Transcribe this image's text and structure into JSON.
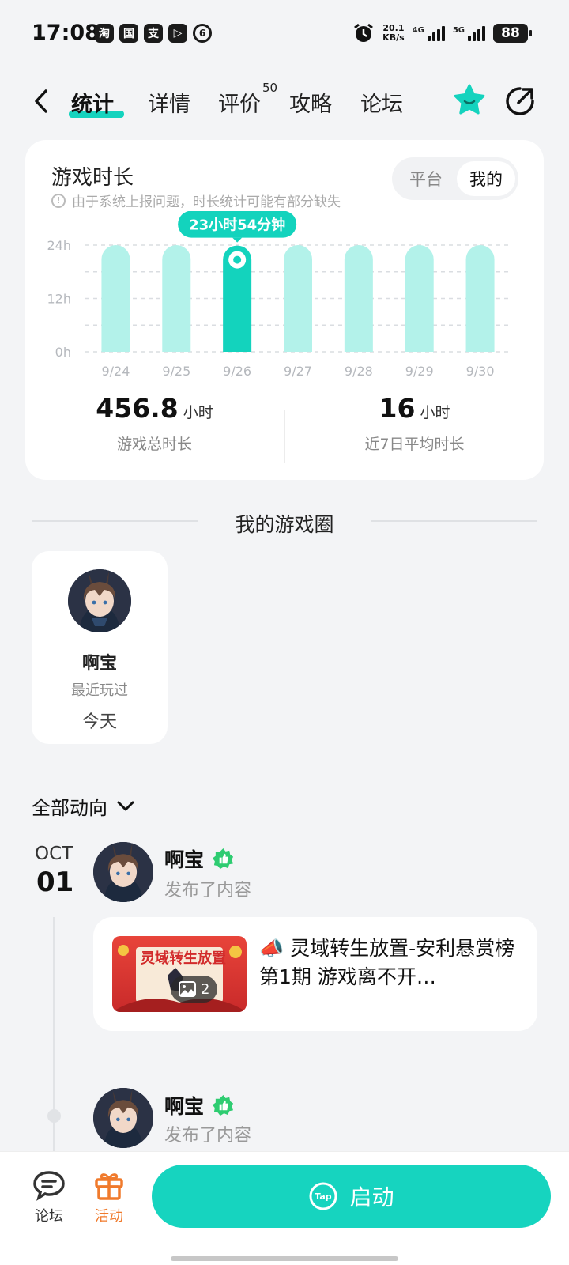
{
  "status_bar": {
    "time": "17:08",
    "apps": [
      "淘",
      "国",
      "支",
      "▷",
      "6"
    ],
    "speed_value": "20.1",
    "speed_unit": "KB/s",
    "net1": "4G",
    "net2": "5G",
    "battery": "88"
  },
  "nav": {
    "tabs": [
      {
        "label": "统计",
        "active": true
      },
      {
        "label": "详情"
      },
      {
        "label": "评价"
      },
      {
        "label": "攻略"
      },
      {
        "label": "论坛"
      }
    ],
    "review_badge": "50",
    "icons": [
      "back-icon",
      "favorite-star-icon",
      "share-icon"
    ]
  },
  "playtime_card": {
    "title": "游戏时长",
    "note": "由于系统上报问题，时长统计可能有部分缺失",
    "toggle": {
      "options": [
        "平台",
        "我的"
      ],
      "selected": "我的"
    },
    "tooltip": "23小时54分钟",
    "total_value": "456.8",
    "total_unit": "小时",
    "total_label": "游戏总时长",
    "avg_value": "16",
    "avg_unit": "小时",
    "avg_label": "近7日平均时长"
  },
  "chart_data": {
    "type": "bar",
    "title": "游戏时长",
    "categories": [
      "9/24",
      "9/25",
      "9/26",
      "9/27",
      "9/28",
      "9/29",
      "9/30"
    ],
    "values": [
      24,
      24,
      23.9,
      24,
      24,
      24,
      24
    ],
    "highlight_index": 2,
    "yticks": [
      "0h",
      "12h",
      "24h"
    ],
    "ylim": [
      0,
      24
    ],
    "colors": {
      "bar": "#b3f2ea",
      "highlight": "#13d3bd",
      "grid": "#dadde1",
      "tick": "#b5b8bd"
    }
  },
  "game_circle": {
    "title": "我的游戏圈",
    "player": {
      "name": "啊宝",
      "sub": "最近玩过",
      "when": "今天"
    }
  },
  "activity": {
    "filter_label": "全部动向",
    "date": {
      "month": "OCT",
      "day": "01"
    },
    "entries": [
      {
        "name": "啊宝",
        "action": "发布了内容"
      },
      {
        "name": "啊宝",
        "action": "发布了内容"
      }
    ],
    "post": {
      "text": "📣 灵域转生放置-安利悬赏榜第1期 游戏离不开…",
      "thumb_title": "灵域转生放置",
      "image_count": "2"
    }
  },
  "bottom_bar": {
    "forum_label": "论坛",
    "event_label": "活动",
    "launch_label": "启动",
    "launch_logo": "Tap"
  },
  "colors": {
    "accent": "#16d4bf",
    "event": "#f07a2c",
    "verified": "#2ecc71"
  }
}
